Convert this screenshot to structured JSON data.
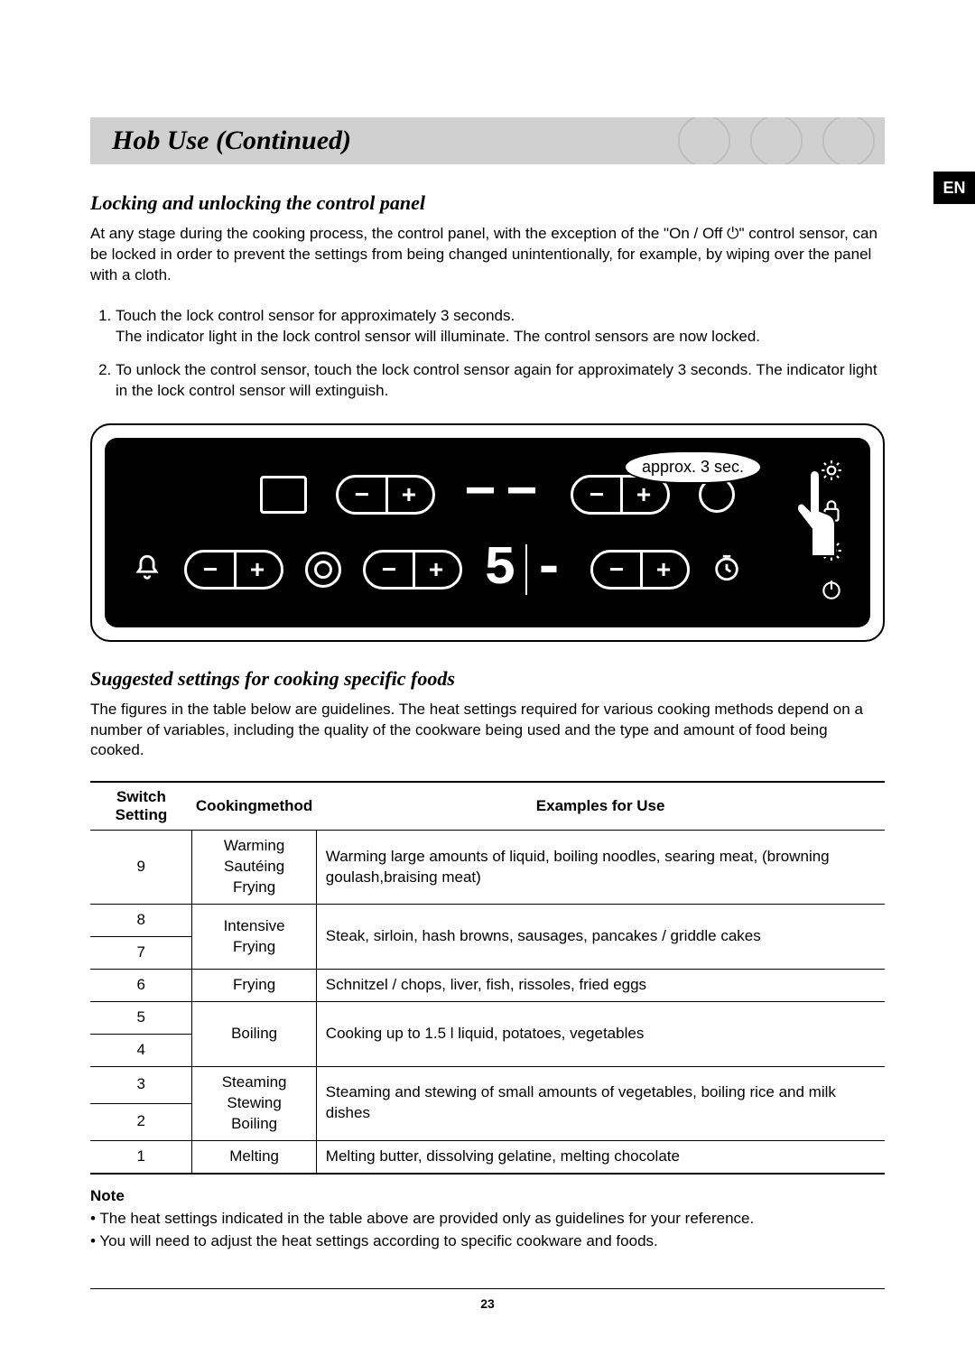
{
  "lang_badge": "EN",
  "header": {
    "title": "Hob Use (Continued)"
  },
  "section1": {
    "heading": "Locking and unlocking the control panel",
    "intro": "At any stage during the cooking process, the control panel, with the exception of the \"On / Off ⏻\" control sensor, can be locked in order to prevent the settings from being changed unintentionally, for example, by wiping over the panel with a cloth.",
    "steps": [
      "Touch the lock control sensor for approximately 3 seconds.\nThe indicator light in the lock control sensor will illuminate. The control sensors are now locked.",
      "To unlock the control sensor, touch the lock control sensor again for approximately 3 seconds. The indicator light in the lock control sensor will extinguish."
    ],
    "callout": "approx. 3 sec.",
    "display": [
      "5",
      "-"
    ]
  },
  "section2": {
    "heading": "Suggested settings for cooking specific foods",
    "intro": "The figures in the table below are guidelines. The heat settings required for various cooking methods depend on a number of variables, including the quality of the cookware being used and the type and amount of food being cooked.",
    "table": {
      "headers": [
        "Switch Setting",
        "Cookingmethod",
        "Examples for Use"
      ],
      "rows": [
        {
          "setting": "9",
          "method": "Warming\nSautéing\nFrying",
          "example": "Warming large amounts of liquid, boiling noodles, searing meat, (browning goulash,braising meat)",
          "mspan": 1,
          "espan": 1
        },
        {
          "setting": "8",
          "method": "Intensive\nFrying",
          "example": "Steak, sirloin, hash browns, sausages, pancakes / griddle cakes",
          "mspan": 2,
          "espan": 2
        },
        {
          "setting": "7"
        },
        {
          "setting": "6",
          "method": "Frying",
          "example": "Schnitzel / chops, liver, fish, rissoles, fried eggs",
          "mspan": 1,
          "espan": 1
        },
        {
          "setting": "5",
          "method": "Boiling",
          "example": "Cooking up to 1.5 l liquid, potatoes, vegetables",
          "mspan": 2,
          "espan": 2
        },
        {
          "setting": "4"
        },
        {
          "setting": "3",
          "method": "Steaming\nStewing\nBoiling",
          "example": "Steaming and stewing of small amounts of vegetables, boiling rice and milk dishes",
          "mspan": 2,
          "espan": 2
        },
        {
          "setting": "2"
        },
        {
          "setting": "1",
          "method": "Melting",
          "example": "Melting butter, dissolving gelatine, melting chocolate",
          "mspan": 1,
          "espan": 1
        }
      ]
    },
    "note_heading": "Note",
    "notes": [
      "The heat settings indicated in the table above are provided only as guidelines for your reference.",
      "You will need to adjust the heat settings according to specific cookware and foods."
    ]
  },
  "page_number": "23"
}
